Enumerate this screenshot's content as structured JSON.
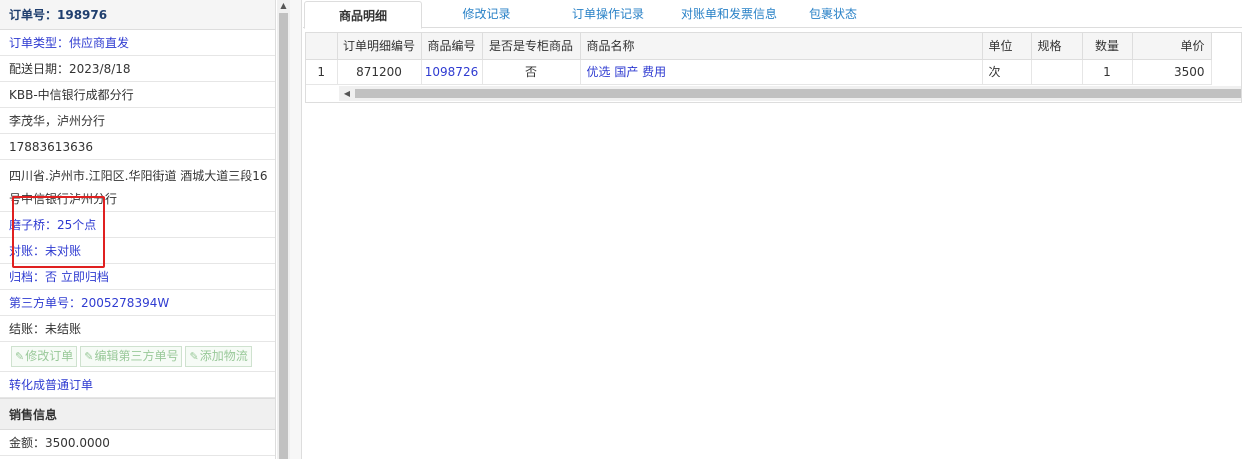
{
  "left_panel": {
    "order_label": "订单号：198976",
    "rows": [
      {
        "text": "订单类型：供应商直发",
        "style": "blue"
      },
      {
        "text": "配送日期：2023/8/18",
        "style": "plain"
      },
      {
        "text": "KBB-中信银行成都分行",
        "style": "plain"
      },
      {
        "text": "李茂华，泸州分行",
        "style": "plain"
      },
      {
        "text": "17883613636",
        "style": "plain"
      }
    ],
    "address_line1": "四川省.泸州市.江阳区.华阳街道 酒城大道三段16",
    "address_line2": "号中信银行泸州分行",
    "rows2": [
      {
        "text": "磨子桥：25个点",
        "style": "blue"
      },
      {
        "text": "对账：未对账",
        "style": "blue"
      },
      {
        "text": "归档：否 立即归档",
        "style": "blue"
      },
      {
        "text": "第三方单号：2005278394W",
        "style": "blue"
      },
      {
        "text": "结账：未结账",
        "style": "plain"
      }
    ],
    "buttons": {
      "modify_order": "修改订单",
      "edit_third_party": "编辑第三方单号",
      "add_logistics": "添加物流"
    },
    "convert_link": "转化成普通订单",
    "sales_section_title": "销售信息",
    "amount": "金额：3500.0000"
  },
  "tabs": [
    {
      "label": "商品明细",
      "active": true
    },
    {
      "label": "修改记录",
      "active": false
    },
    {
      "label": "订单操作记录",
      "active": false
    },
    {
      "label": "对账单和发票信息",
      "active": false
    },
    {
      "label": "包裹状态",
      "active": false
    }
  ],
  "table": {
    "headers": [
      "",
      "订单明细编号",
      "商品编号",
      "是否是专柜商品",
      "商品名称",
      "单位",
      "规格",
      "数量",
      "单价"
    ],
    "rows": [
      [
        "1",
        "871200",
        "1098726",
        "否",
        "优选 国产 费用",
        "次",
        "",
        "1",
        "3500"
      ]
    ]
  },
  "colors": {
    "link_blue": "#2f3bd1",
    "tab_blue": "#2a82c7",
    "highlight_red": "#e02020"
  }
}
